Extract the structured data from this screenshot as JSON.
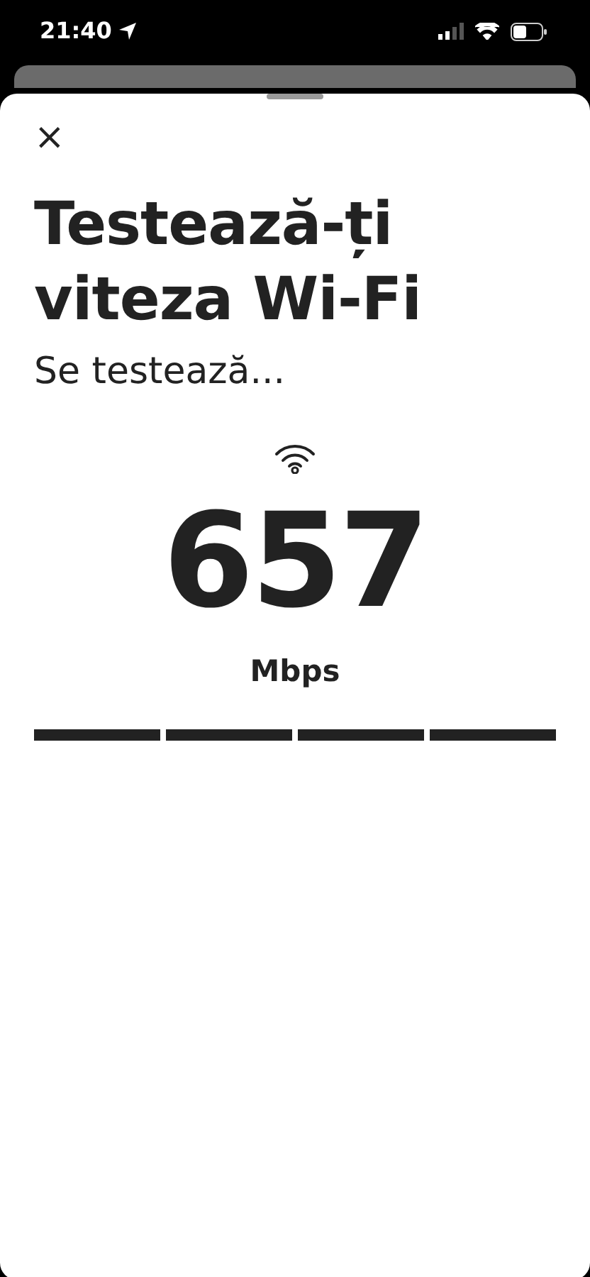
{
  "status_bar": {
    "time": "21:40"
  },
  "sheet": {
    "close": "×",
    "title": "Testează-ți viteza Wi-Fi",
    "subtitle": "Se testează...",
    "speed": "657",
    "unit": "Mbps"
  },
  "progress": [
    {
      "level": 1
    },
    {
      "level": 1
    },
    {
      "level": 1
    },
    {
      "level": 1
    }
  ]
}
